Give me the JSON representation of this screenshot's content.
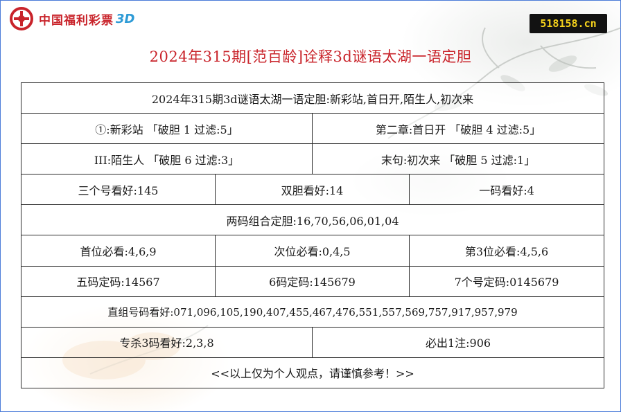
{
  "logo": {
    "text": "中国福利彩票",
    "suffix": "3D"
  },
  "site_badge": "518158.cn",
  "title": "2024年315期[范百龄]诠释3d谜语太湖一语定胆",
  "table": {
    "header": "2024年315期3d谜语太湖一语定胆:新彩站,首日开,陌生人,初次来",
    "row2": {
      "left": "①:新彩站  「破胆 1 过滤:5」",
      "right": "第二章:首日开  「破胆 4 过滤:5」"
    },
    "row3": {
      "left": "III:陌生人  「破胆 6 过滤:3」",
      "right": "末句:初次来  「破胆 5 过滤:1」"
    },
    "row4": {
      "c1": "三个号看好:145",
      "c2": "双胆看好:14",
      "c3": "一码看好:4"
    },
    "row5": "两码组合定胆:16,70,56,06,01,04",
    "row6": {
      "c1": "首位必看:4,6,9",
      "c2": "次位必看:0,4,5",
      "c3": "第3位必看:4,5,6"
    },
    "row7": {
      "c1": "五码定码:14567",
      "c2": "6码定码:145679",
      "c3": "7个号定码:0145679"
    },
    "row8": "直组号码看好:071,096,105,190,407,455,467,476,551,557,569,757,917,957,979",
    "row9": {
      "left": "专杀3码看好:2,3,8",
      "right": "必出1注:906"
    },
    "row10": "<<以上仅为个人观点，请谨慎参考！>>"
  }
}
